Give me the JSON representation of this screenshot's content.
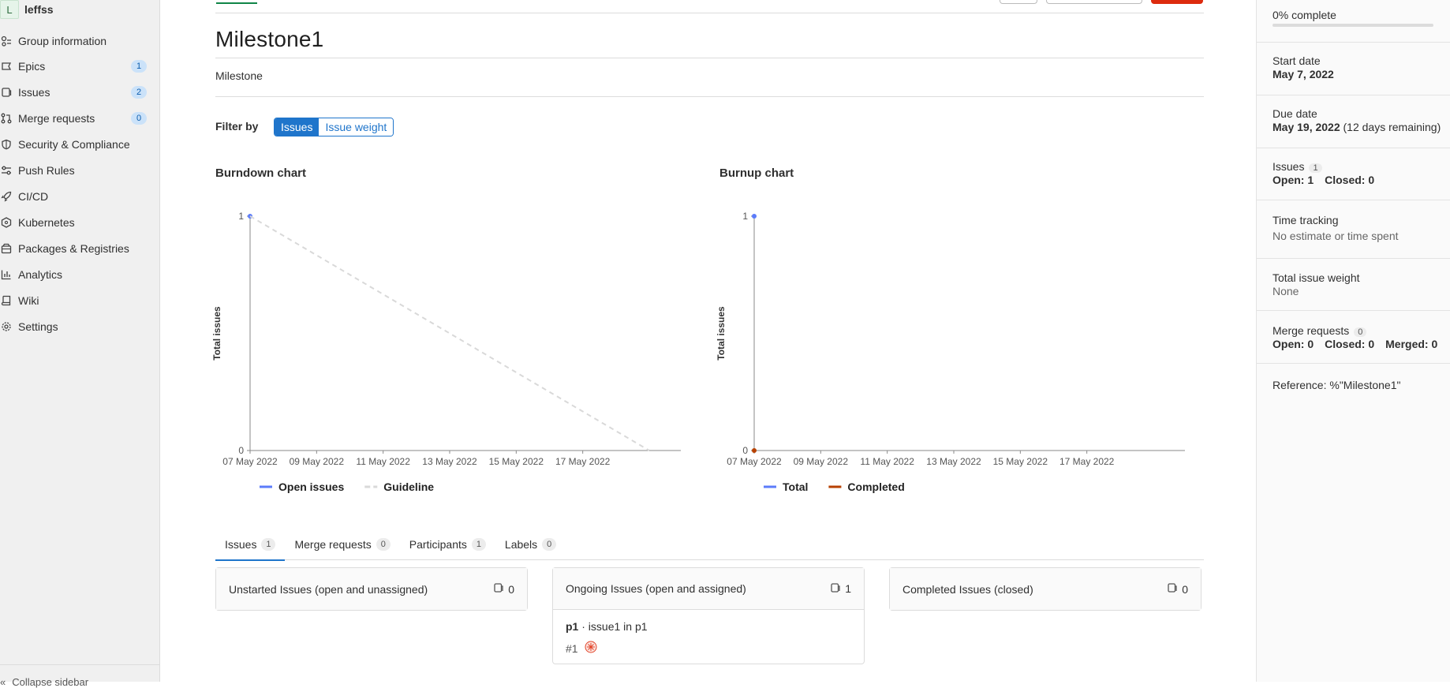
{
  "sidebar": {
    "group_avatar": "L",
    "group_name": "leffss",
    "items": [
      {
        "label": "Group information",
        "icon": "group-info-icon"
      },
      {
        "label": "Epics",
        "icon": "epic-icon",
        "count": "1"
      },
      {
        "label": "Issues",
        "icon": "issues-icon",
        "count": "2"
      },
      {
        "label": "Merge requests",
        "icon": "merge-request-icon",
        "count": "0"
      },
      {
        "label": "Security & Compliance",
        "icon": "shield-icon"
      },
      {
        "label": "Push Rules",
        "icon": "push-rules-icon"
      },
      {
        "label": "CI/CD",
        "icon": "rocket-icon"
      },
      {
        "label": "Kubernetes",
        "icon": "kubernetes-icon"
      },
      {
        "label": "Packages & Registries",
        "icon": "package-icon"
      },
      {
        "label": "Analytics",
        "icon": "chart-icon"
      },
      {
        "label": "Wiki",
        "icon": "book-icon"
      },
      {
        "label": "Settings",
        "icon": "gear-icon"
      }
    ],
    "collapse_label": "Collapse sidebar"
  },
  "milestone": {
    "title": "Milestone1",
    "description": "Milestone"
  },
  "filter": {
    "label": "Filter by",
    "options": [
      "Issues",
      "Issue weight"
    ],
    "selected": "Issues"
  },
  "colors": {
    "accent": "#1f75cb",
    "open_issues": "#5c7cfa",
    "completed": "#b74100",
    "guideline": "#d9d9d9",
    "danger": "#dd2b0e"
  },
  "chart_data": [
    {
      "type": "line",
      "title": "Burndown chart",
      "ylabel": "Total issues",
      "ylim": [
        0,
        1
      ],
      "yticks": [
        "0",
        "1"
      ],
      "x_range": [
        "2022-05-07",
        "2022-05-19"
      ],
      "xticks": [
        "07 May 2022",
        "09 May 2022",
        "11 May 2022",
        "13 May 2022",
        "15 May 2022",
        "17 May 2022"
      ],
      "grid": false,
      "legend_placement": "bottom",
      "series": [
        {
          "name": "Open issues",
          "x": [
            "2022-05-07"
          ],
          "y": [
            1
          ],
          "color": "#5c7cfa"
        },
        {
          "name": "Guideline",
          "x": [
            "2022-05-07",
            "2022-05-19"
          ],
          "y": [
            1,
            0
          ],
          "color": "#d9d9d9",
          "dashed": true
        }
      ]
    },
    {
      "type": "line",
      "title": "Burnup chart",
      "ylabel": "Total issues",
      "ylim": [
        0,
        1
      ],
      "yticks": [
        "0",
        "1"
      ],
      "x_range": [
        "2022-05-07",
        "2022-05-19"
      ],
      "xticks": [
        "07 May 2022",
        "09 May 2022",
        "11 May 2022",
        "13 May 2022",
        "15 May 2022",
        "17 May 2022"
      ],
      "grid": false,
      "legend_placement": "bottom",
      "series": [
        {
          "name": "Total",
          "x": [
            "2022-05-07"
          ],
          "y": [
            1
          ],
          "color": "#5c7cfa"
        },
        {
          "name": "Completed",
          "x": [
            "2022-05-07"
          ],
          "y": [
            0
          ],
          "color": "#b74100"
        }
      ]
    }
  ],
  "tabs": [
    {
      "label": "Issues",
      "count": "1"
    },
    {
      "label": "Merge requests",
      "count": "0"
    },
    {
      "label": "Participants",
      "count": "1"
    },
    {
      "label": "Labels",
      "count": "0"
    }
  ],
  "boards": [
    {
      "title": "Unstarted Issues (open and unassigned)",
      "count": "0"
    },
    {
      "title": "Ongoing Issues (open and assigned)",
      "count": "1"
    },
    {
      "title": "Completed Issues (closed)",
      "count": "0"
    }
  ],
  "issue_card": {
    "project": "p1",
    "separator": " · ",
    "text": "issue1 in p1",
    "ref": "#1"
  },
  "right_sidebar": {
    "progress_text": "0% complete",
    "progress_value": 0,
    "start_date_label": "Start date",
    "start_date": "May 7, 2022",
    "due_date_label": "Due date",
    "due_date": "May 19, 2022",
    "due_remaining": "(12 days remaining)",
    "issues_label": "Issues",
    "issues_count": "1",
    "issues_open": "Open: 1",
    "issues_closed": "Closed: 0",
    "time_tracking_label": "Time tracking",
    "time_tracking_value": "No estimate or time spent",
    "weight_label": "Total issue weight",
    "weight_value": "None",
    "mr_label": "Merge requests",
    "mr_count": "0",
    "mr_open": "Open: 0",
    "mr_closed": "Closed: 0",
    "mr_merged": "Merged: 0",
    "reference": "Reference: %\"Milestone1\""
  }
}
